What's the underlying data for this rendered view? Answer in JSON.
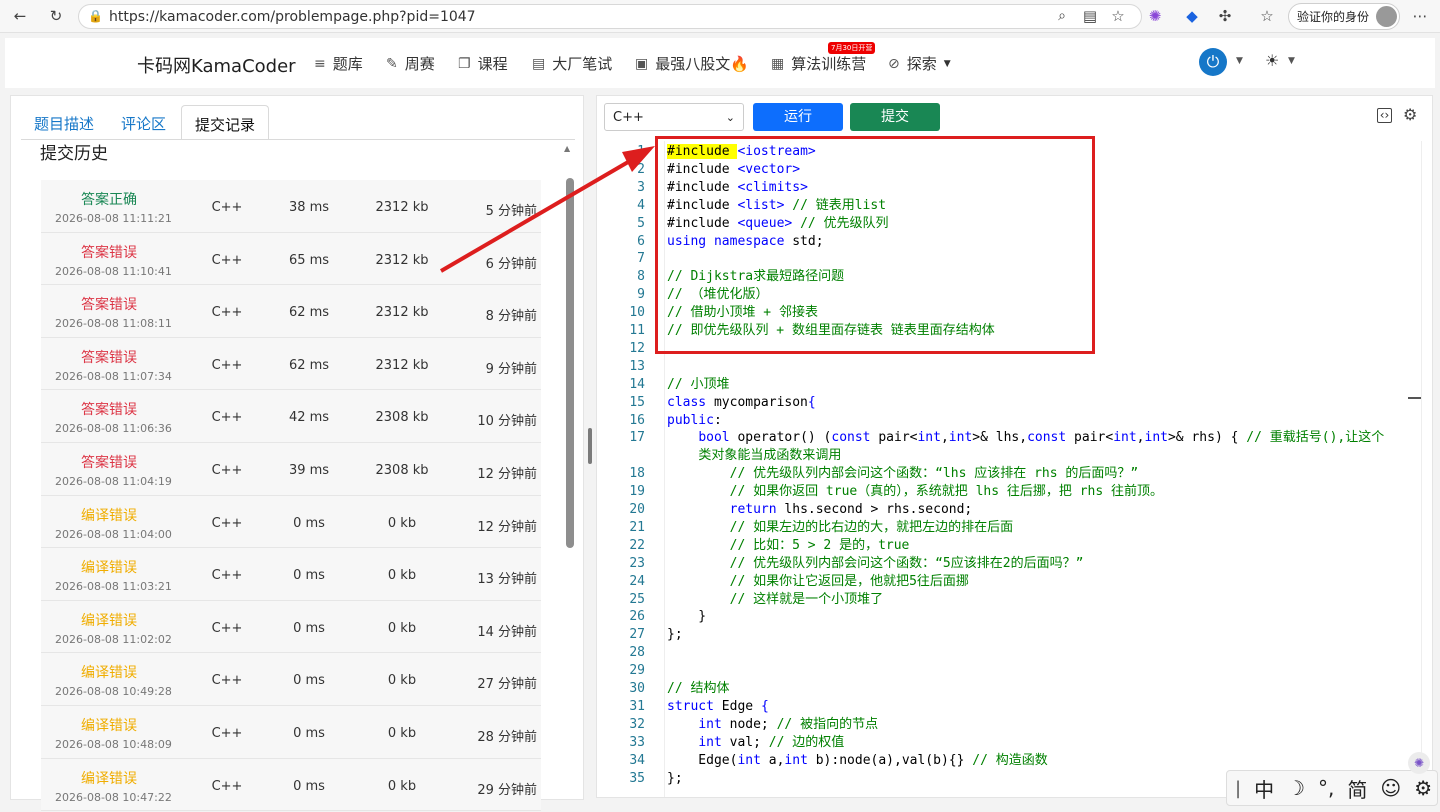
{
  "browser": {
    "url": "https://kamacoder.com/problempage.php?pid=1047",
    "profile_label": "验证你的身份"
  },
  "nav": {
    "logo": "卡码网KamaCoder",
    "items": [
      "题库",
      "周赛",
      "课程",
      "大厂笔试",
      "最强八股文🔥",
      "算法训练营",
      "探索"
    ],
    "badge": "7月30日开营"
  },
  "left": {
    "tabs": [
      "题目描述",
      "评论区",
      "提交记录"
    ],
    "title": "提交历史",
    "rows": [
      {
        "status": "答案正确",
        "date": "2026-08-08 11:11:21",
        "lang": "C++",
        "time": "38 ms",
        "mem": "2312 kb",
        "ago": "5 分钟前",
        "color": "#198754"
      },
      {
        "status": "答案错误",
        "date": "2026-08-08 11:10:41",
        "lang": "C++",
        "time": "65 ms",
        "mem": "2312 kb",
        "ago": "6 分钟前",
        "color": "#dc3545"
      },
      {
        "status": "答案错误",
        "date": "2026-08-08 11:08:11",
        "lang": "C++",
        "time": "62 ms",
        "mem": "2312 kb",
        "ago": "8 分钟前",
        "color": "#dc3545"
      },
      {
        "status": "答案错误",
        "date": "2026-08-08 11:07:34",
        "lang": "C++",
        "time": "62 ms",
        "mem": "2312 kb",
        "ago": "9 分钟前",
        "color": "#dc3545"
      },
      {
        "status": "答案错误",
        "date": "2026-08-08 11:06:36",
        "lang": "C++",
        "time": "42 ms",
        "mem": "2308 kb",
        "ago": "10 分钟前",
        "color": "#dc3545"
      },
      {
        "status": "答案错误",
        "date": "2026-08-08 11:04:19",
        "lang": "C++",
        "time": "39 ms",
        "mem": "2308 kb",
        "ago": "12 分钟前",
        "color": "#dc3545"
      },
      {
        "status": "编译错误",
        "date": "2026-08-08 11:04:00",
        "lang": "C++",
        "time": "0 ms",
        "mem": "0 kb",
        "ago": "12 分钟前",
        "color": "#f0ad00"
      },
      {
        "status": "编译错误",
        "date": "2026-08-08 11:03:21",
        "lang": "C++",
        "time": "0 ms",
        "mem": "0 kb",
        "ago": "13 分钟前",
        "color": "#f0ad00"
      },
      {
        "status": "编译错误",
        "date": "2026-08-08 11:02:02",
        "lang": "C++",
        "time": "0 ms",
        "mem": "0 kb",
        "ago": "14 分钟前",
        "color": "#f0ad00"
      },
      {
        "status": "编译错误",
        "date": "2026-08-08 10:49:28",
        "lang": "C++",
        "time": "0 ms",
        "mem": "0 kb",
        "ago": "27 分钟前",
        "color": "#f0ad00"
      },
      {
        "status": "编译错误",
        "date": "2026-08-08 10:48:09",
        "lang": "C++",
        "time": "0 ms",
        "mem": "0 kb",
        "ago": "28 分钟前",
        "color": "#f0ad00"
      },
      {
        "status": "编译错误",
        "date": "2026-08-08 10:47:22",
        "lang": "C++",
        "time": "0 ms",
        "mem": "0 kb",
        "ago": "29 分钟前",
        "color": "#f0ad00"
      }
    ]
  },
  "editor": {
    "language": "C++",
    "run_label": "运行",
    "submit_label": "提交",
    "lines": [
      {
        "n": "1",
        "html": "<span class='hl'>#include </span><span class='kw'>&lt;iostream&gt;</span>"
      },
      {
        "n": "2",
        "html": "#include <span class='kw'>&lt;vector&gt;</span>"
      },
      {
        "n": "3",
        "html": "#include <span class='kw'>&lt;climits&gt;</span>"
      },
      {
        "n": "4",
        "html": "#include <span class='kw'>&lt;list&gt;</span> <span class='cm'>// 链表用list</span>"
      },
      {
        "n": "5",
        "html": "#include <span class='kw'>&lt;queue&gt;</span> <span class='cm'>// 优先级队列</span>"
      },
      {
        "n": "6",
        "html": "<span class='kw'>using namespace</span> std;"
      },
      {
        "n": "7",
        "html": ""
      },
      {
        "n": "8",
        "html": "<span class='cm'>// Dijkstra求最短路径问题</span>"
      },
      {
        "n": "9",
        "html": "<span class='cm'>// （堆优化版）</span>"
      },
      {
        "n": "10",
        "html": "<span class='cm'>// 借助小顶堆 + 邻接表</span>"
      },
      {
        "n": "11",
        "html": "<span class='cm'>// 即优先级队列 + 数组里面存链表 链表里面存结构体</span>"
      },
      {
        "n": "12",
        "html": ""
      },
      {
        "n": "13",
        "html": ""
      },
      {
        "n": "14",
        "html": "<span class='cm'>// 小顶堆</span>"
      },
      {
        "n": "15",
        "html": "<span class='kw'>class</span> mycomparison<span class='kw'>{</span>"
      },
      {
        "n": "16",
        "html": "<span class='kw'>public</span>:"
      },
      {
        "n": "17",
        "html": "    <span class='kw'>bool</span> operator() (<span class='kw'>const</span> pair&lt;<span class='kw'>int</span>,<span class='kw'>int</span>&gt;&amp; lhs,<span class='kw'>const</span> pair&lt;<span class='kw'>int</span>,<span class='kw'>int</span>&gt;&amp; rhs) { <span class='cm'>// 重载括号(),让这个</span>"
      },
      {
        "n": "",
        "html": "    <span class='cm'>类对象能当成函数来调用</span>"
      },
      {
        "n": "18",
        "html": "        <span class='cm'>// 优先级队列内部会问这个函数：“lhs 应该排在 rhs 的后面吗？”</span>"
      },
      {
        "n": "19",
        "html": "        <span class='cm'>// 如果你返回 true（真的），系统就把 lhs 往后挪，把 rhs 往前顶。</span>"
      },
      {
        "n": "20",
        "html": "        <span class='kw'>return</span> lhs.second &gt; rhs.second;"
      },
      {
        "n": "21",
        "html": "        <span class='cm'>// 如果左边的比右边的大，就把左边的排在后面</span>"
      },
      {
        "n": "22",
        "html": "        <span class='cm'>// 比如：5 &gt; 2 是的，true</span>"
      },
      {
        "n": "23",
        "html": "        <span class='cm'>// 优先级队列内部会问这个函数：“5应该排在2的后面吗？”</span>"
      },
      {
        "n": "24",
        "html": "        <span class='cm'>// 如果你让它返回是，他就把5往后面挪</span>"
      },
      {
        "n": "25",
        "html": "        <span class='cm'>// 这样就是一个小顶堆了</span>"
      },
      {
        "n": "26",
        "html": "    }"
      },
      {
        "n": "27",
        "html": "};"
      },
      {
        "n": "28",
        "html": ""
      },
      {
        "n": "29",
        "html": ""
      },
      {
        "n": "30",
        "html": "<span class='cm'>// 结构体</span>"
      },
      {
        "n": "31",
        "html": "<span class='kw'>struct</span> Edge <span class='kw'>{</span>"
      },
      {
        "n": "32",
        "html": "    <span class='kw'>int</span> node; <span class='cm'>// 被指向的节点</span>"
      },
      {
        "n": "33",
        "html": "    <span class='kw'>int</span> val; <span class='cm'>// 边的权值</span>"
      },
      {
        "n": "34",
        "html": "    Edge(<span class='kw'>int</span> a,<span class='kw'>int</span> b):node(a),val(b){} <span class='cm'>// 构造函数</span>"
      },
      {
        "n": "35",
        "html": "};"
      }
    ]
  },
  "ime": {
    "items": [
      "中",
      "☽",
      "°,",
      "简",
      "☺",
      "⚙"
    ]
  }
}
